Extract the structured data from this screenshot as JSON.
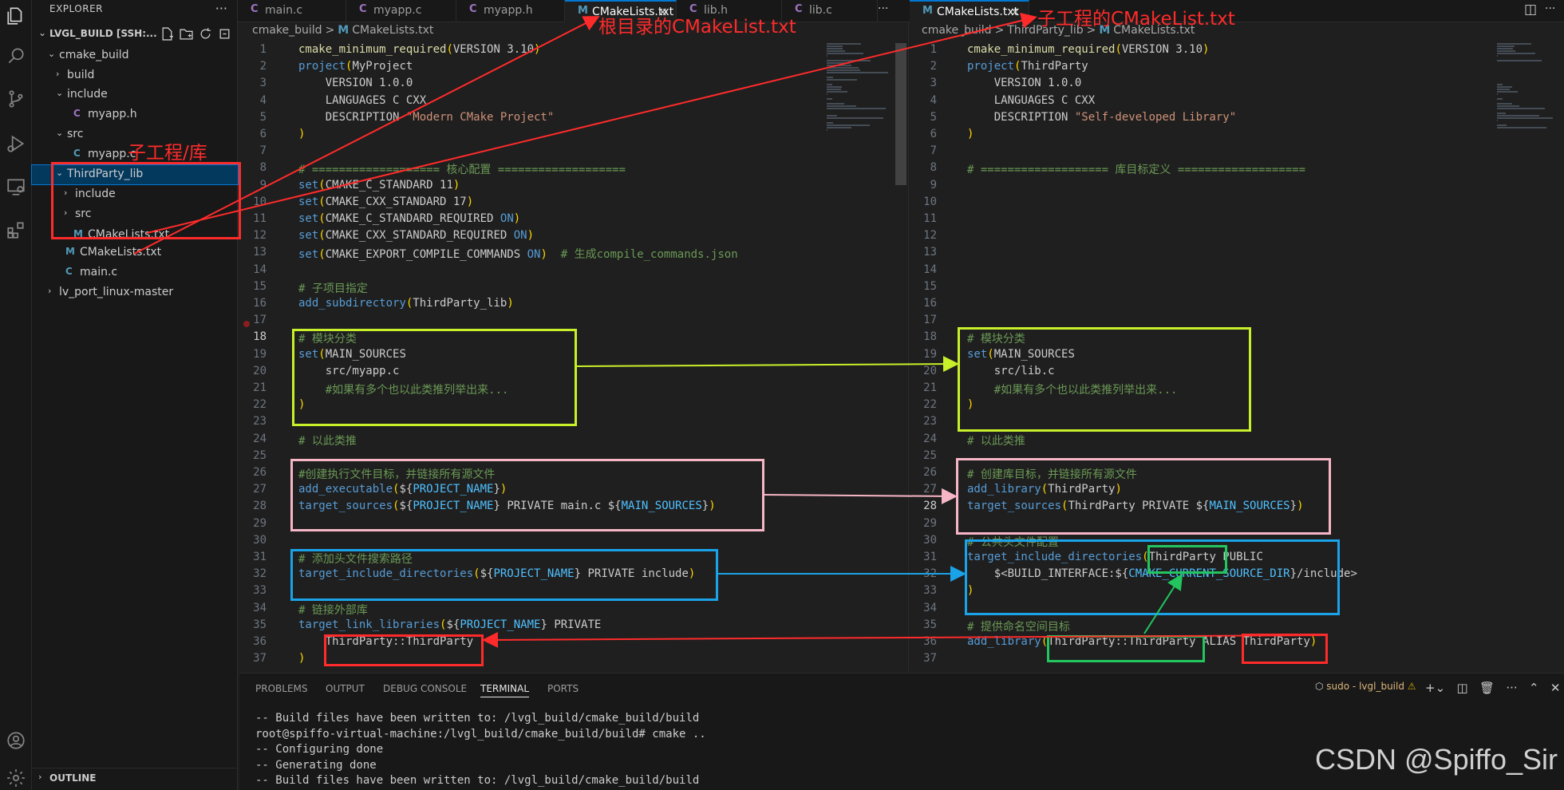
{
  "explorer": {
    "title": "EXPLORER",
    "more": "···",
    "workspace": "LVGL_BUILD [SSH:...",
    "tree": [
      {
        "name": "cmake_build",
        "type": "folder",
        "open": true
      },
      {
        "name": "build",
        "type": "folder",
        "open": false
      },
      {
        "name": "include",
        "type": "folder",
        "open": true
      },
      {
        "name": "myapp.h",
        "type": "h"
      },
      {
        "name": "src",
        "type": "folder",
        "open": true
      },
      {
        "name": "myapp.c",
        "type": "c"
      },
      {
        "name": "ThirdParty_lib",
        "type": "folder",
        "open": true
      },
      {
        "name": "include",
        "type": "folder",
        "open": false
      },
      {
        "name": "src",
        "type": "folder",
        "open": false
      },
      {
        "name": "CMakeLists.txt",
        "type": "m"
      },
      {
        "name": "CMakeLists.txt",
        "type": "m"
      },
      {
        "name": "main.c",
        "type": "c"
      },
      {
        "name": "lv_port_linux-master",
        "type": "folder",
        "open": false
      }
    ],
    "outline": "OUTLINE"
  },
  "tabs_left": [
    {
      "name": "main.c",
      "icon": "C",
      "active": false
    },
    {
      "name": "myapp.c",
      "icon": "C",
      "active": false
    },
    {
      "name": "myapp.h",
      "icon": "C",
      "active": false
    },
    {
      "name": "CMakeLists.txt",
      "icon": "M",
      "active": true
    },
    {
      "name": "lib.h",
      "icon": "C",
      "active": false
    },
    {
      "name": "lib.c",
      "icon": "C",
      "active": false
    }
  ],
  "tabs_more": "···",
  "tabs_right": [
    {
      "name": "CMakeLists.txt",
      "icon": "M",
      "active": true
    }
  ],
  "breadcrumb_left": [
    "cmake_build",
    ">",
    "M",
    "CMakeLists.txt"
  ],
  "breadcrumb_right": [
    "cmake_build",
    ">",
    "ThirdParty_lib",
    ">",
    "M",
    "CMakeLists.txt"
  ],
  "editor_left": {
    "current_line": 18,
    "lines": [
      [
        [
          "k-fn",
          "cmake_minimum_required"
        ],
        [
          "k-par",
          "("
        ],
        [
          "k-plain",
          "VERSION 3.10"
        ],
        [
          "k-par",
          ")"
        ]
      ],
      [
        [
          "k-kw",
          "project"
        ],
        [
          "k-par",
          "("
        ],
        [
          "k-plain",
          "MyProject"
        ]
      ],
      [
        [
          "k-plain",
          "    VERSION 1.0.0"
        ]
      ],
      [
        [
          "k-plain",
          "    LANGUAGES C CXX"
        ]
      ],
      [
        [
          "k-plain",
          "    DESCRIPTION "
        ],
        [
          "k-str",
          "\"Modern CMake Project\""
        ]
      ],
      [
        [
          "k-par",
          ")"
        ]
      ],
      [],
      [
        [
          "k-cm",
          "# =================== 核心配置 ==================="
        ]
      ],
      [
        [
          "k-kw",
          "set"
        ],
        [
          "k-par",
          "("
        ],
        [
          "k-plain",
          "CMAKE_C_STANDARD 11"
        ],
        [
          "k-par",
          ")"
        ]
      ],
      [
        [
          "k-kw",
          "set"
        ],
        [
          "k-par",
          "("
        ],
        [
          "k-plain",
          "CMAKE_CXX_STANDARD 17"
        ],
        [
          "k-par",
          ")"
        ]
      ],
      [
        [
          "k-kw",
          "set"
        ],
        [
          "k-par",
          "("
        ],
        [
          "k-plain",
          "CMAKE_C_STANDARD_REQUIRED "
        ],
        [
          "k-kw",
          "ON"
        ],
        [
          "k-par",
          ")"
        ]
      ],
      [
        [
          "k-kw",
          "set"
        ],
        [
          "k-par",
          "("
        ],
        [
          "k-plain",
          "CMAKE_CXX_STANDARD_REQUIRED "
        ],
        [
          "k-kw",
          "ON"
        ],
        [
          "k-par",
          ")"
        ]
      ],
      [
        [
          "k-kw",
          "set"
        ],
        [
          "k-par",
          "("
        ],
        [
          "k-plain",
          "CMAKE_EXPORT_COMPILE_COMMANDS "
        ],
        [
          "k-kw",
          "ON"
        ],
        [
          "k-par",
          ")"
        ],
        [
          "k-cm",
          "  # 生成compile_commands.json"
        ]
      ],
      [],
      [
        [
          "k-cm",
          "# 子项目指定"
        ]
      ],
      [
        [
          "k-kw",
          "add_subdirectory"
        ],
        [
          "k-par",
          "("
        ],
        [
          "k-plain",
          "ThirdParty_lib"
        ],
        [
          "k-par",
          ")"
        ]
      ],
      [],
      [
        [
          "k-cm",
          "# 模块分类"
        ]
      ],
      [
        [
          "k-kw",
          "set"
        ],
        [
          "k-par",
          "("
        ],
        [
          "k-plain",
          "MAIN_SOURCES"
        ]
      ],
      [
        [
          "k-plain",
          "    src/myapp.c"
        ]
      ],
      [
        [
          "k-cm",
          "    #如果有多个也以此类推列举出来..."
        ]
      ],
      [
        [
          "k-par",
          ")"
        ]
      ],
      [],
      [
        [
          "k-cm",
          "# 以此类推"
        ]
      ],
      [],
      [
        [
          "k-cm",
          "#创建执行文件目标，并链接所有源文件"
        ]
      ],
      [
        [
          "k-kw",
          "add_executable"
        ],
        [
          "k-par",
          "("
        ],
        [
          "k-plain",
          "${"
        ],
        [
          "k-var",
          "PROJECT_NAME"
        ],
        [
          "k-plain",
          "}"
        ],
        [
          "k-par",
          ")"
        ]
      ],
      [
        [
          "k-kw",
          "target_sources"
        ],
        [
          "k-par",
          "("
        ],
        [
          "k-plain",
          "${"
        ],
        [
          "k-var",
          "PROJECT_NAME"
        ],
        [
          "k-plain",
          "} PRIVATE main.c ${"
        ],
        [
          "k-var",
          "MAIN_SOURCES"
        ],
        [
          "k-plain",
          "}"
        ],
        [
          "k-par",
          ")"
        ]
      ],
      [],
      [],
      [
        [
          "k-cm",
          "# 添加头文件搜索路径"
        ]
      ],
      [
        [
          "k-kw",
          "target_include_directories"
        ],
        [
          "k-par",
          "("
        ],
        [
          "k-plain",
          "${"
        ],
        [
          "k-var",
          "PROJECT_NAME"
        ],
        [
          "k-plain",
          "} PRIVATE include"
        ],
        [
          "k-par",
          ")"
        ]
      ],
      [],
      [
        [
          "k-cm",
          "# 链接外部库"
        ]
      ],
      [
        [
          "k-kw",
          "target_link_libraries"
        ],
        [
          "k-par",
          "("
        ],
        [
          "k-plain",
          "${"
        ],
        [
          "k-var",
          "PROJECT_NAME"
        ],
        [
          "k-plain",
          "} PRIVATE"
        ]
      ],
      [
        [
          "k-plain",
          "    ThirdParty::ThirdParty"
        ]
      ],
      [
        [
          "k-par",
          ")"
        ]
      ]
    ]
  },
  "editor_right": {
    "current_line": 28,
    "lines": [
      [
        [
          "k-fn",
          "cmake_minimum_required"
        ],
        [
          "k-par",
          "("
        ],
        [
          "k-plain",
          "VERSION 3.10"
        ],
        [
          "k-par",
          ")"
        ]
      ],
      [
        [
          "k-kw",
          "project"
        ],
        [
          "k-par",
          "("
        ],
        [
          "k-plain",
          "ThirdParty"
        ]
      ],
      [
        [
          "k-plain",
          "    VERSION 1.0.0"
        ]
      ],
      [
        [
          "k-plain",
          "    LANGUAGES C CXX"
        ]
      ],
      [
        [
          "k-plain",
          "    DESCRIPTION "
        ],
        [
          "k-str",
          "\"Self-developed Library\""
        ]
      ],
      [
        [
          "k-par",
          ")"
        ]
      ],
      [],
      [
        [
          "k-cm",
          "# =================== 库目标定义 ==================="
        ]
      ],
      [],
      [],
      [],
      [],
      [],
      [],
      [],
      [],
      [],
      [
        [
          "k-cm",
          "# 模块分类"
        ]
      ],
      [
        [
          "k-kw",
          "set"
        ],
        [
          "k-par",
          "("
        ],
        [
          "k-plain",
          "MAIN_SOURCES"
        ]
      ],
      [
        [
          "k-plain",
          "    src/lib.c"
        ]
      ],
      [
        [
          "k-cm",
          "    #如果有多个也以此类推列举出来..."
        ]
      ],
      [
        [
          "k-par",
          ")"
        ]
      ],
      [],
      [
        [
          "k-cm",
          "# 以此类推"
        ]
      ],
      [],
      [
        [
          "k-cm",
          "# 创建库目标，并链接所有源文件"
        ]
      ],
      [
        [
          "k-kw",
          "add_library"
        ],
        [
          "k-par",
          "("
        ],
        [
          "k-plain",
          "ThirdParty"
        ],
        [
          "k-par",
          ")"
        ]
      ],
      [
        [
          "k-kw",
          "target_sources"
        ],
        [
          "k-par",
          "("
        ],
        [
          "k-plain",
          "ThirdParty PRIVATE ${"
        ],
        [
          "k-var",
          "MAIN_SOURCES"
        ],
        [
          "k-plain",
          "}"
        ],
        [
          "k-par",
          ")"
        ]
      ],
      [],
      [
        [
          "k-cm",
          "# 公共头文件配置"
        ]
      ],
      [
        [
          "k-kw",
          "target_include_directories"
        ],
        [
          "k-par",
          "("
        ],
        [
          "k-plain",
          "ThirdParty PUBLIC"
        ]
      ],
      [
        [
          "k-plain",
          "    $<BUILD_INTERFACE:${"
        ],
        [
          "k-var",
          "CMAKE_CURRENT_SOURCE_DIR"
        ],
        [
          "k-plain",
          "}/include>"
        ]
      ],
      [
        [
          "k-par",
          ")"
        ]
      ],
      [],
      [
        [
          "k-cm",
          "# 提供命名空间目标"
        ]
      ],
      [
        [
          "k-kw",
          "add_library"
        ],
        [
          "k-par",
          "("
        ],
        [
          "k-plain",
          "ThirdParty::ThirdParty ALIAS ThirdParty"
        ],
        [
          "k-par",
          ")"
        ]
      ],
      []
    ]
  },
  "annotations": {
    "root_label": "根目录的CMakeList.txt",
    "sub_label": "子工程的CMakeList.txt",
    "lib_label": "子工程/库"
  },
  "panel": {
    "tabs": [
      "PROBLEMS",
      "OUTPUT",
      "DEBUG CONSOLE",
      "TERMINAL",
      "PORTS"
    ],
    "active_tab": "TERMINAL",
    "terminal_name": "sudo - lvgl_build",
    "terminal": [
      "-- Build files have been written to: /lvgl_build/cmake_build/build",
      "root@spiffo-virtual-machine:/lvgl_build/cmake_build/build# cmake ..",
      "-- Configuring done",
      "-- Generating done",
      "-- Build files have been written to: /lvgl_build/cmake_build/build"
    ]
  },
  "watermark": "CSDN @Spiffo_Sir",
  "colors": {
    "red": "#ff2b2b",
    "yellow_green": "#c8f02a",
    "pink": "#f7b6c6",
    "blue": "#1aa3e8",
    "green": "#22c55e"
  }
}
